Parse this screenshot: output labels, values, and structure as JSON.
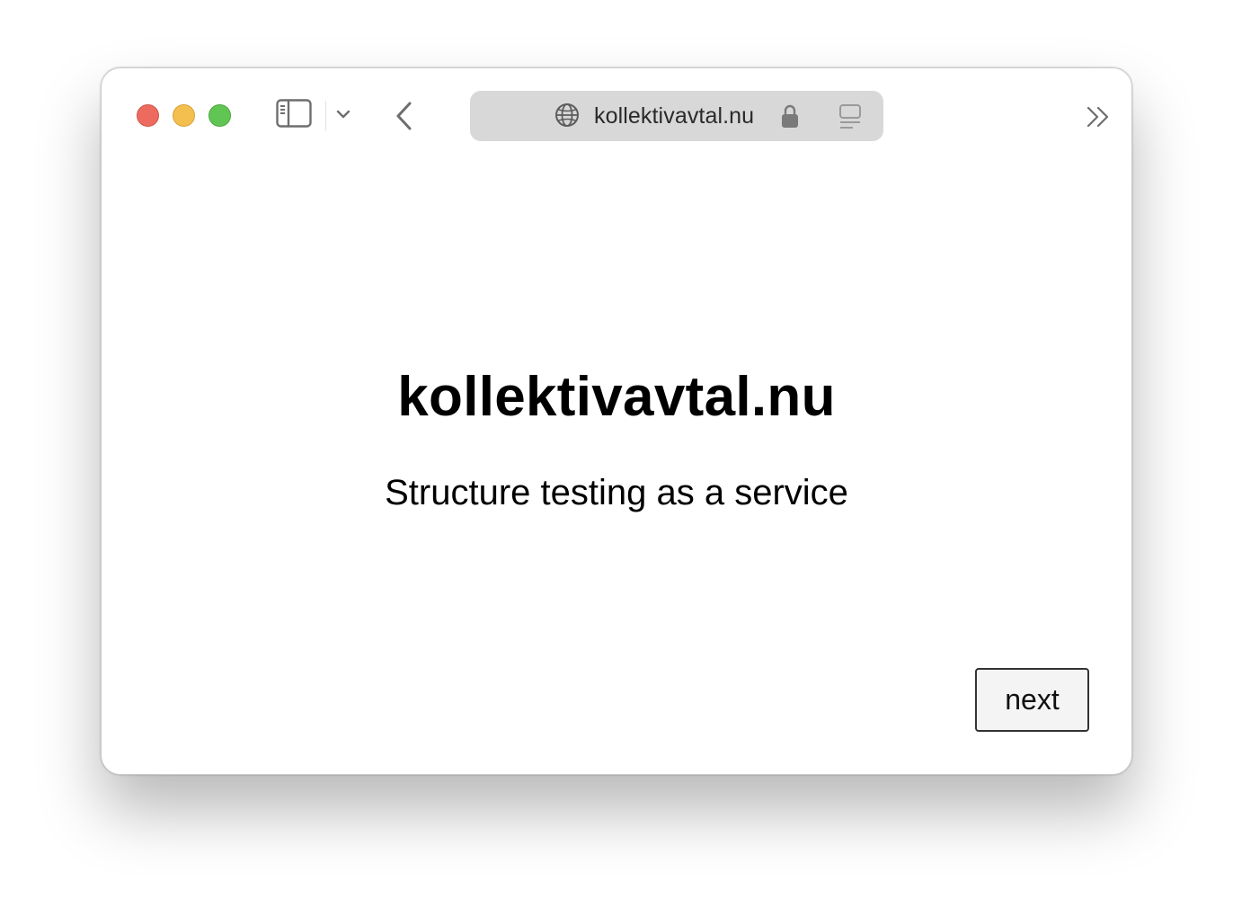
{
  "browser": {
    "address_bar": {
      "url": "kollektivavtal.nu"
    },
    "icons": {
      "sidebar": "sidebar-icon",
      "tab_group_menu": "chevron-down-icon",
      "back": "back-icon",
      "site": "globe-icon",
      "security": "lock-icon",
      "reader": "reader-icon",
      "overflow": "chevron-double-right-icon"
    },
    "traffic_lights": {
      "close_color": "#ed6a5e",
      "minimize_color": "#f5bf4f",
      "zoom_color": "#61c554"
    }
  },
  "page": {
    "title": "kollektivavtal.nu",
    "tagline": "Structure testing as a service",
    "next_button_label": "next"
  }
}
